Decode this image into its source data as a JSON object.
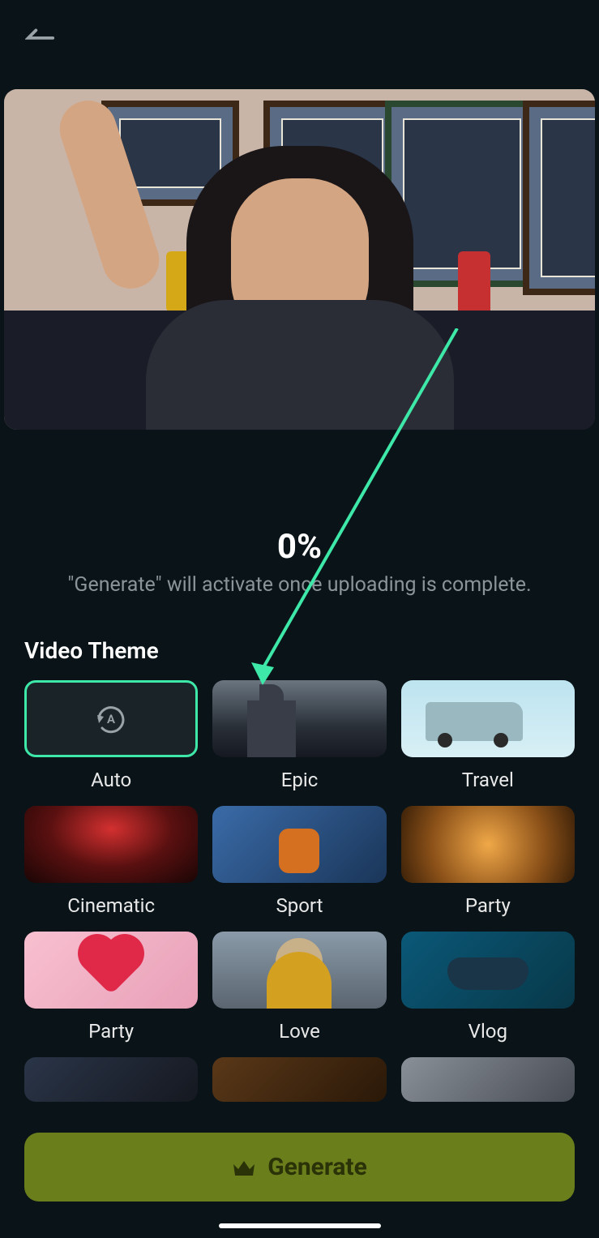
{
  "progress": {
    "percent": "0%",
    "hint": "\"Generate\" will activate once uploading is complete."
  },
  "section": {
    "title": "Video Theme"
  },
  "themes": [
    {
      "id": "auto",
      "label": "Auto",
      "selected": true
    },
    {
      "id": "epic",
      "label": "Epic",
      "selected": false
    },
    {
      "id": "travel",
      "label": "Travel",
      "selected": false
    },
    {
      "id": "cinematic",
      "label": "Cinematic",
      "selected": false
    },
    {
      "id": "sport",
      "label": "Sport",
      "selected": false
    },
    {
      "id": "party",
      "label": "Party",
      "selected": false
    },
    {
      "id": "party2",
      "label": "Party",
      "selected": false
    },
    {
      "id": "love",
      "label": "Love",
      "selected": false
    },
    {
      "id": "vlog",
      "label": "Vlog",
      "selected": false
    }
  ],
  "generate": {
    "label": "Generate"
  },
  "colors": {
    "accent": "#3de8a8",
    "background": "#0a1418",
    "generate_bg": "#6b7e1c"
  }
}
